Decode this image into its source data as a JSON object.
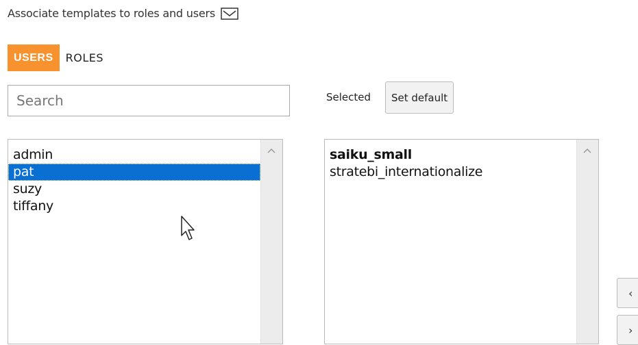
{
  "header": {
    "title": "Associate templates to roles and users"
  },
  "tabs": [
    {
      "label": "USERS",
      "active": true
    },
    {
      "label": "ROLES",
      "active": false
    }
  ],
  "search": {
    "placeholder": "Search",
    "value": ""
  },
  "selection": {
    "label": "Selected",
    "set_default_label": "Set default"
  },
  "users": [
    "admin",
    "pat",
    "suzy",
    "tiffany"
  ],
  "selected_user": "pat",
  "templates": [
    {
      "name": "saiku_small",
      "default": true
    },
    {
      "name": "stratebi_internationalize",
      "default": false
    }
  ],
  "side_buttons": [
    "‹",
    "›"
  ],
  "colors": {
    "accent": "#f7922f",
    "selection": "#0a6fd3"
  }
}
